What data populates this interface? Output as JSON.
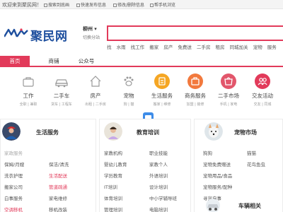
{
  "topbar": {
    "welcome": "欢迎来到聚民网！",
    "links": [
      "搜索到底画",
      "快速发布信息",
      "修改/删除信息",
      "帮手机浏览"
    ]
  },
  "header": {
    "logo_text": "聚民网",
    "city": {
      "name": "柳州",
      "switch_label": "切换分站"
    },
    "search": {
      "placeholder": "",
      "value": ""
    },
    "hot_words": [
      "找",
      "水雨",
      "找工作",
      "搬家",
      "房产",
      "免费送",
      "二手房",
      "租房",
      "同城加关",
      "宠物",
      "服务"
    ]
  },
  "nav": {
    "tabs": [
      "首页",
      "商铺",
      "公众号"
    ],
    "active_index": 0
  },
  "categories": [
    {
      "label": "工作",
      "sub": "全职 | 兼职",
      "icon": "briefcase-icon",
      "color": "#f4f4f4"
    },
    {
      "label": "二手车",
      "sub": "货车 | 工程车",
      "icon": "car-icon",
      "color": "#f4f4f4"
    },
    {
      "label": "房产",
      "sub": "出租 | 二手房",
      "icon": "house-icon",
      "color": "#f4f4f4"
    },
    {
      "label": "宠物",
      "sub": "狗 | 猫",
      "icon": "paw-icon",
      "color": "#f4f4f4"
    },
    {
      "label": "生活服务",
      "sub": "搬家 | 维修",
      "icon": "service-icon",
      "color": "#f5a623"
    },
    {
      "label": "商务服务",
      "sub": "加盟 | 装修",
      "icon": "business-icon",
      "color": "#f2793d"
    },
    {
      "label": "二手市场",
      "sub": "手机 | 家电",
      "icon": "market-icon",
      "color": "#e2566b"
    },
    {
      "label": "交友活动",
      "sub": "交友 | 同城",
      "icon": "friends-icon",
      "color": "#e23a5a"
    }
  ],
  "panels": {
    "life": {
      "title": "生活服务",
      "items": [
        "家政服务",
        "保姆/月嫂",
        "保洁/清洗",
        "洗衣护理",
        "生活配送",
        "搬家公司",
        "管道疏通",
        "白事服务",
        "家电维修",
        "空调移机",
        "移机改装"
      ]
    },
    "training": {
      "title": "教育培训",
      "items": [
        "家教机构",
        "职业技能",
        "婴幼儿教育",
        "家教个人",
        "学历教育",
        "外语培训",
        "IT培训",
        "设计培训",
        "体育培训",
        "中小学辅导班",
        "管理培训",
        "电脑培训"
      ]
    },
    "pets": {
      "title": "宠物市场",
      "items": [
        "狗狗",
        "猫猫",
        "宠物免费赠送",
        "花鸟鱼虫",
        "宠物用品/食品",
        "宠物服务/配种",
        "寻宠启事"
      ]
    },
    "vehicles": {
      "title": "车辆相关"
    }
  },
  "colors": {
    "accent": "#e23a5a",
    "logo": "#1e4f9e"
  }
}
